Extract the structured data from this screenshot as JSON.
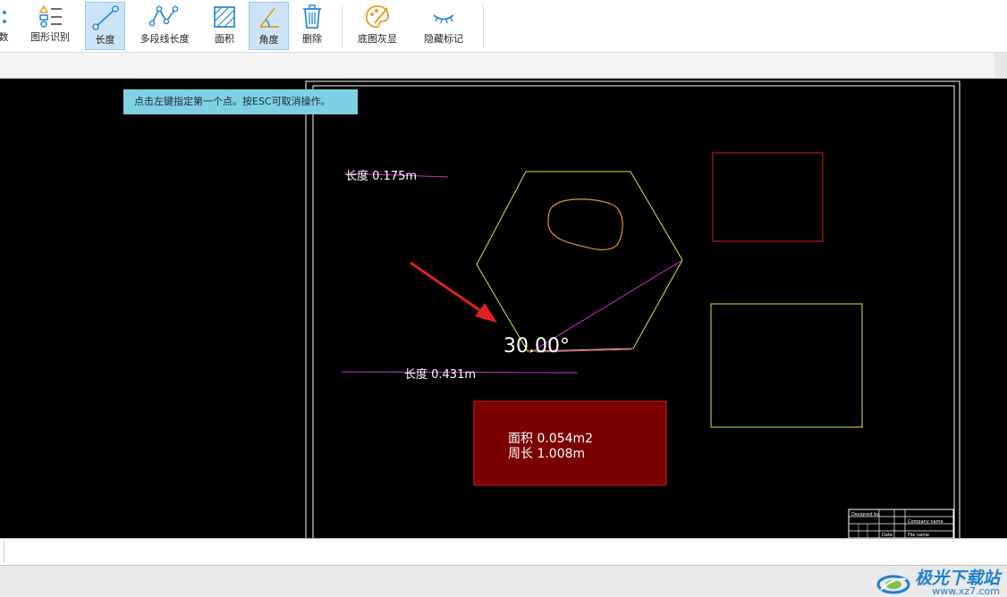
{
  "toolbar": {
    "partial_label": "数",
    "items": [
      {
        "label": "图形识别",
        "icon": "shape-recognition-icon"
      },
      {
        "label": "长度",
        "icon": "length-icon",
        "active": true
      },
      {
        "label": "多段线长度",
        "icon": "polyline-length-icon"
      },
      {
        "label": "面积",
        "icon": "area-icon"
      },
      {
        "label": "角度",
        "icon": "angle-icon",
        "active": true
      },
      {
        "label": "删除",
        "icon": "delete-icon"
      },
      {
        "label": "底图灰显",
        "icon": "gray-base-map-icon"
      },
      {
        "label": "隐藏标记",
        "icon": "hide-marks-icon"
      }
    ]
  },
  "tooltip": "点击左键指定第一个点。按ESC可取消操作。",
  "drawing": {
    "length_label_1": "长度 0.175m",
    "length_label_2": "长度 0.431m",
    "angle_label": "30.00°",
    "area_label": "面积 0.054m2",
    "perimeter_label": "周长 1.008m",
    "title_block": {
      "designed_by": "Designed by",
      "company": "Company name",
      "date": "Date",
      "file_name": "File name"
    }
  },
  "colors": {
    "canvas_bg": "#000000",
    "hexagon": "#e6e040",
    "measure_line": "#cc33cc",
    "red_rect": "#d11f1f",
    "area_fill": "#7a0000",
    "yellow_rect": "#e6e040",
    "orange_blob": "#e8902a",
    "arrow": "#e02020",
    "tooltip_bg": "#7fd0e3",
    "accent": "#1f7fd2"
  },
  "watermark": {
    "brand": "极光下载站",
    "url": "www.xz7.com"
  }
}
